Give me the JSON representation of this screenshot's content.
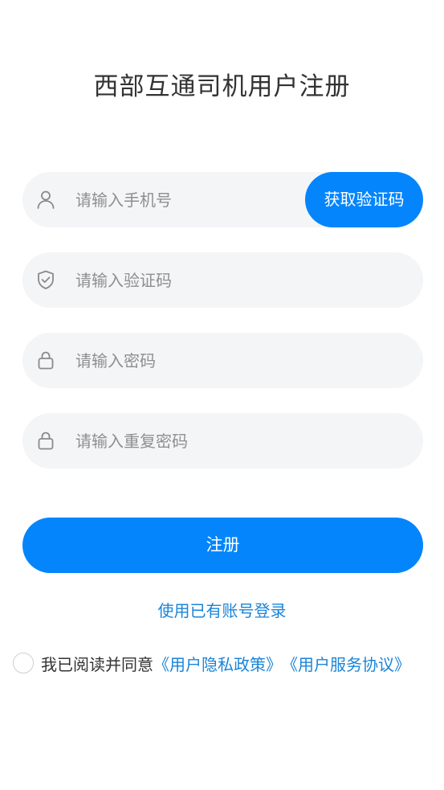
{
  "title": "西部互通司机用户注册",
  "form": {
    "phone": {
      "placeholder": "请输入手机号",
      "value": "",
      "icon": "user-icon"
    },
    "get_code_label": "获取验证码",
    "code": {
      "placeholder": "请输入验证码",
      "value": "",
      "icon": "shield-check-icon"
    },
    "password": {
      "placeholder": "请输入密码",
      "value": "",
      "icon": "lock-icon"
    },
    "confirm_password": {
      "placeholder": "请输入重复密码",
      "value": "",
      "icon": "lock-icon"
    },
    "register_label": "注册"
  },
  "login_link": "使用已有账号登录",
  "agreement": {
    "text": "我已阅读并同意",
    "privacy_policy": "《用户隐私政策》",
    "service_agreement": "《用户服务协议》",
    "checked": false
  },
  "colors": {
    "primary": "#0485fb",
    "link": "#1a84d8",
    "field_bg": "#f4f5f7",
    "title": "#333333",
    "placeholder": "#8f8f8f"
  }
}
